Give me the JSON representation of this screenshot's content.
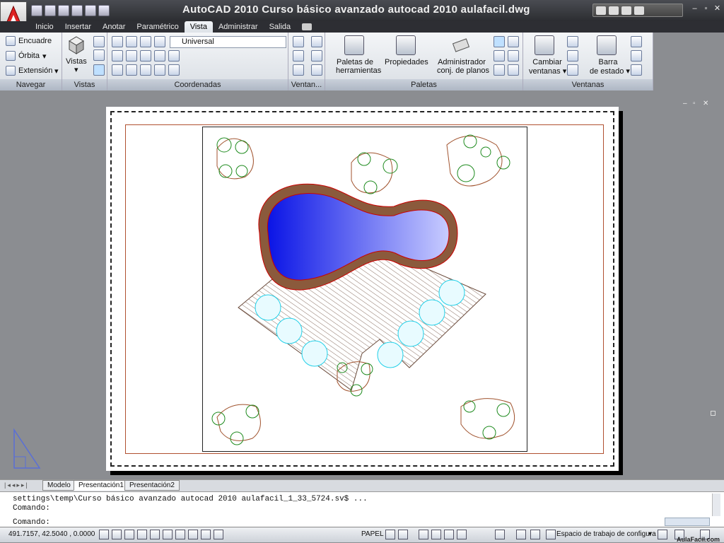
{
  "app": {
    "title": "AutoCAD 2010   Curso básico avanzado autocad 2010 aulafacil.dwg",
    "window_controls": [
      "–",
      "▫",
      "✕"
    ]
  },
  "ribbon_tabs": [
    "Inicio",
    "Insertar",
    "Anotar",
    "Paramétrico",
    "Vista",
    "Administrar",
    "Salida"
  ],
  "active_tab": "Vista",
  "navegar": {
    "title": "Navegar",
    "items": [
      "Encuadre",
      "Órbita",
      "Extensión"
    ]
  },
  "vistas": {
    "title": "Vistas",
    "button": "Vistas"
  },
  "coordenadas": {
    "title": "Coordenadas",
    "ucs_value": "Universal"
  },
  "ventanas_small": {
    "title": "Ventan..."
  },
  "paletas": {
    "title": "Paletas",
    "buttons": [
      {
        "line1": "Paletas de",
        "line2": "herramientas"
      },
      {
        "line1": "Propiedades",
        "line2": ""
      },
      {
        "line1": "Administrador",
        "line2": "conj. de planos"
      }
    ]
  },
  "ventanas": {
    "title": "Ventanas",
    "buttons": [
      {
        "line1": "Cambiar",
        "line2": "ventanas"
      },
      {
        "line1": "Barra",
        "line2": "de estado"
      }
    ]
  },
  "layout_tabs": [
    "Modelo",
    "Presentación1",
    "Presentación2"
  ],
  "active_layout": "Presentación1",
  "command": {
    "history": [
      "settings\\temp\\Curso básico avanzado autocad 2010 aulafacil_1_33_5724.sv$ ...",
      "Comando:"
    ],
    "prompt": "Comando:"
  },
  "status": {
    "coordinates": "491.7157, 42.5040 , 0.0000",
    "space": "PAPEL",
    "workspace": "Espacio de trabajo de configura",
    "watermark": "AulaFacil.com"
  },
  "colors": {
    "pool_water_deep": "#0a14e6",
    "pool_water_light": "#c8ccff",
    "pool_edge": "#8b5a3c",
    "tree_green": "#1d8a1d",
    "umbrella_cyan": "#22d0e8"
  }
}
